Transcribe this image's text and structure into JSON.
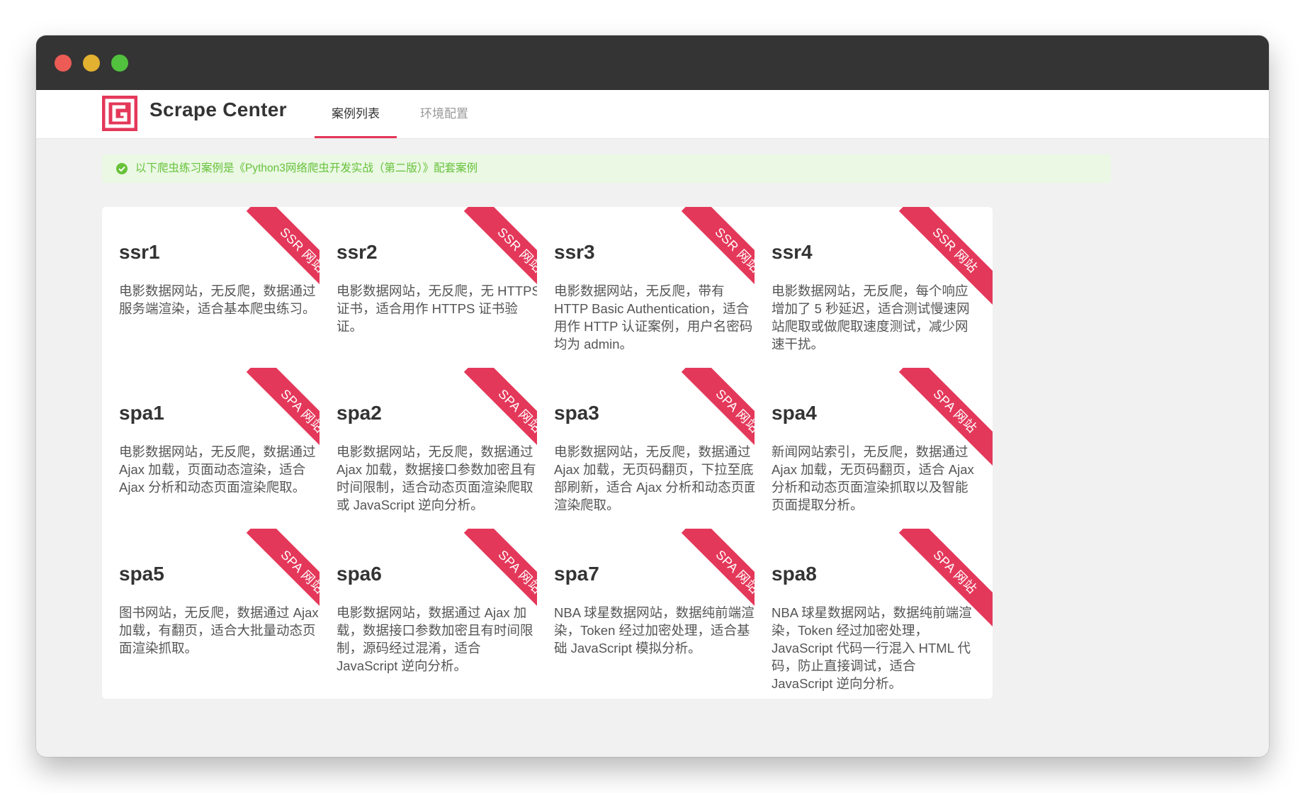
{
  "brand": {
    "name": "Scrape Center"
  },
  "nav": {
    "tabs": [
      {
        "label": "案例列表",
        "active": true
      },
      {
        "label": "环境配置",
        "active": false
      }
    ]
  },
  "notice": {
    "text": "以下爬虫练习案例是《Python3网络爬虫开发实战（第二版）》配套案例"
  },
  "colors": {
    "accent": "#e4385a",
    "success": "#67c23a",
    "titlebar": "#343434"
  },
  "cards": [
    {
      "title": "ssr1",
      "tag": "SSR 网站",
      "desc": "电影数据网站，无反爬，数据通过服务端渲染，适合基本爬虫练习。"
    },
    {
      "title": "ssr2",
      "tag": "SSR 网站",
      "desc": "电影数据网站，无反爬，无 HTTPS 证书，适合用作 HTTPS 证书验证。"
    },
    {
      "title": "ssr3",
      "tag": "SSR 网站",
      "desc": "电影数据网站，无反爬，带有 HTTP Basic Authentication，适合用作 HTTP 认证案例，用户名密码均为 admin。"
    },
    {
      "title": "ssr4",
      "tag": "SSR 网站",
      "desc": "电影数据网站，无反爬，每个响应增加了 5 秒延迟，适合测试慢速网站爬取或做爬取速度测试，减少网速干扰。"
    },
    {
      "title": "spa1",
      "tag": "SPA 网站",
      "desc": "电影数据网站，无反爬，数据通过 Ajax 加载，页面动态渲染，适合 Ajax 分析和动态页面渲染爬取。"
    },
    {
      "title": "spa2",
      "tag": "SPA 网站",
      "desc": "电影数据网站，无反爬，数据通过 Ajax 加载，数据接口参数加密且有时间限制，适合动态页面渲染爬取或 JavaScript 逆向分析。"
    },
    {
      "title": "spa3",
      "tag": "SPA 网站",
      "desc": "电影数据网站，无反爬，数据通过 Ajax 加载，无页码翻页，下拉至底部刷新，适合 Ajax 分析和动态页面渲染爬取。"
    },
    {
      "title": "spa4",
      "tag": "SPA 网站",
      "desc": "新闻网站索引，无反爬，数据通过 Ajax 加载，无页码翻页，适合 Ajax 分析和动态页面渲染抓取以及智能页面提取分析。"
    },
    {
      "title": "spa5",
      "tag": "SPA 网站",
      "desc": "图书网站，无反爬，数据通过 Ajax 加载，有翻页，适合大批量动态页面渲染抓取。"
    },
    {
      "title": "spa6",
      "tag": "SPA 网站",
      "desc": "电影数据网站，数据通过 Ajax 加载，数据接口参数加密且有时间限制，源码经过混淆，适合 JavaScript 逆向分析。"
    },
    {
      "title": "spa7",
      "tag": "SPA 网站",
      "desc": "NBA 球星数据网站，数据纯前端渲染，Token 经过加密处理，适合基础 JavaScript 模拟分析。"
    },
    {
      "title": "spa8",
      "tag": "SPA 网站",
      "desc": "NBA 球星数据网站，数据纯前端渲染，Token 经过加密处理，JavaScript 代码一行混入 HTML 代码，防止直接调试，适合 JavaScript 逆向分析。"
    }
  ]
}
